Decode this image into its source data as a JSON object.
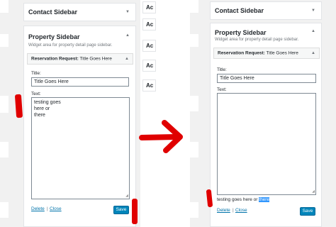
{
  "left": {
    "contact_title": "Contact Sidebar",
    "property_title": "Property Sidebar",
    "description": "Widget area for property detail page sidebar.",
    "widget_prefix": "Reservation Request:",
    "widget_name": "Title Goes Here",
    "title_label": "Title:",
    "title_value": "Title Goes Here",
    "text_label": "Text:",
    "text_value": "testing goes\nhere or\nthere",
    "delete_label": "Delete",
    "separator": "|",
    "close_label": "Close",
    "save_label": "Save"
  },
  "middle": {
    "items": [
      "Ac",
      "Ac",
      "Ac",
      "Ac",
      "Ac"
    ]
  },
  "right": {
    "contact_title": "Contact Sidebar",
    "property_title": "Property Sidebar",
    "description": "Widget area for property detail page sidebar.",
    "widget_prefix": "Reservation Request:",
    "widget_name": "Title Goes Here",
    "title_label": "Title:",
    "title_value": "Title Goes Here",
    "text_label": "Text:",
    "preview_text": "testing goes here or",
    "preview_selected": "there",
    "delete_label": "Delete",
    "separator": "|",
    "close_label": "Close",
    "save_label": "Save"
  },
  "colors": {
    "annotation": "#e00000",
    "link": "#0073aa",
    "primary_button": "#0085ba",
    "selection": "#3297fd"
  }
}
